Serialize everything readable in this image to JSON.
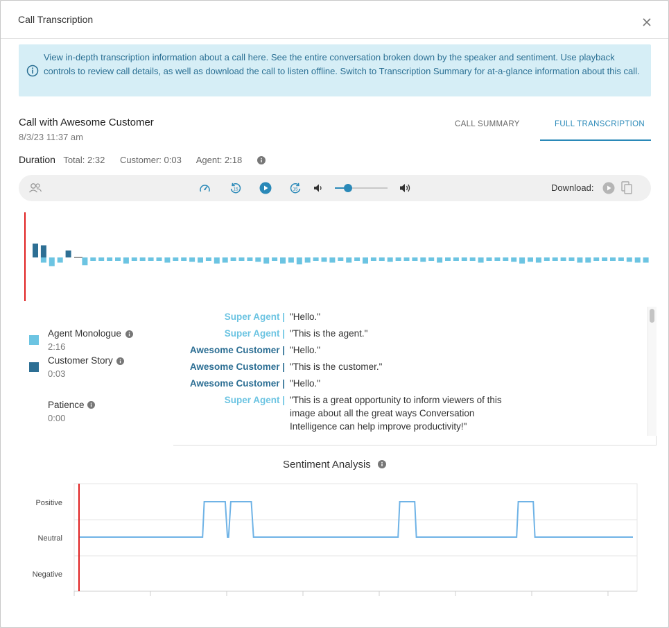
{
  "modal": {
    "title": "Call Transcription"
  },
  "banner": {
    "text": "View in-depth transcription information about a call here. See the entire conversation broken down by the speaker and sentiment. Use playback controls to review call details, as well as download the call to listen offline. Switch to Transcription Summary for at-a-glance information about this call."
  },
  "call": {
    "title": "Call with Awesome Customer",
    "datetime": "8/3/23 11:37 am"
  },
  "tabs": {
    "summary": "CALL SUMMARY",
    "full": "FULL TRANSCRIPTION",
    "active": "FULL TRANSCRIPTION"
  },
  "duration": {
    "label": "Duration",
    "total": "Total: 2:32",
    "customer": "Customer: 0:03",
    "agent": "Agent: 2:18"
  },
  "player": {
    "download_label": "Download:",
    "volume_level": 0.25
  },
  "colors": {
    "agent": "#6cc4e2",
    "customer": "#2d6f94",
    "accent": "#2a89b8",
    "playhead": "#e02020",
    "banner_bg": "#d6eef6"
  },
  "legend": {
    "agent_label": "Agent Monologue",
    "agent_value": "2:16",
    "customer_label": "Customer Story",
    "customer_value": "0:03",
    "patience_label": "Patience",
    "patience_value": "0:00"
  },
  "transcript": [
    {
      "speaker": "Super Agent |",
      "role": "agent",
      "text": "\"Hello.\""
    },
    {
      "speaker": "Super Agent |",
      "role": "agent",
      "text": "\"This is the agent.\""
    },
    {
      "speaker": "Awesome Customer |",
      "role": "customer",
      "text": "\"Hello.\""
    },
    {
      "speaker": "Awesome Customer |",
      "role": "customer",
      "text": "\"This is the customer.\""
    },
    {
      "speaker": "Awesome Customer |",
      "role": "customer",
      "text": "\"Hello.\""
    },
    {
      "speaker": "Super Agent |",
      "role": "agent",
      "text": "\"This is a great opportunity to inform viewers of this image about all the great ways Conversation Intelligence can help improve productivity!\""
    }
  ],
  "sentiment": {
    "title": "Sentiment Analysis",
    "levels": [
      "Positive",
      "Neutral",
      "Negative"
    ]
  },
  "chart_data": [
    {
      "type": "bar",
      "description_series": "speaker activity waveform",
      "series": [
        {
          "name": "Customer Story",
          "x": [
            0,
            1,
            4
          ],
          "values": [
            0.8,
            0.7,
            0.4
          ]
        },
        {
          "name": "Agent Monologue",
          "x": [
            1,
            2,
            3,
            6,
            7,
            8,
            9,
            10,
            11,
            12,
            13,
            14,
            15,
            16,
            17,
            18,
            19,
            20,
            21,
            22,
            23,
            24,
            25,
            26,
            27,
            28,
            29,
            30,
            31,
            32,
            33,
            34,
            35,
            36,
            37,
            38,
            39,
            40,
            41,
            42,
            43,
            44,
            45,
            46,
            47,
            48,
            49,
            50,
            51,
            52,
            53,
            54,
            55,
            56,
            57,
            58,
            59,
            60,
            61,
            62,
            63,
            64,
            65,
            66,
            67,
            68,
            69,
            70,
            71,
            72,
            73,
            74,
            75,
            76,
            77,
            78,
            79,
            80,
            81
          ],
          "values": [
            -0.3,
            -0.5,
            -0.3,
            -0.45,
            -0.2,
            -0.2,
            -0.2,
            -0.2,
            -0.35,
            -0.2,
            -0.2,
            -0.2,
            -0.2,
            -0.3,
            -0.2,
            -0.2,
            -0.25,
            -0.3,
            -0.2,
            -0.35,
            -0.3,
            -0.2,
            -0.2,
            -0.2,
            -0.25,
            -0.35,
            -0.2,
            -0.35,
            -0.3,
            -0.4,
            -0.3,
            -0.2,
            -0.25,
            -0.3,
            -0.2,
            -0.3,
            -0.2,
            -0.35,
            -0.2,
            -0.2,
            -0.25,
            -0.2,
            -0.2,
            -0.2,
            -0.25,
            -0.2,
            -0.3,
            -0.2,
            -0.2,
            -0.2,
            -0.2,
            -0.3,
            -0.2,
            -0.2,
            -0.2,
            -0.25,
            -0.35,
            -0.25,
            -0.3,
            -0.2,
            -0.2,
            -0.2,
            -0.2,
            -0.3,
            -0.3,
            -0.2,
            -0.2,
            -0.2,
            -0.2,
            -0.25,
            -0.3,
            -0.3,
            -0.3,
            -0.25,
            -0.2,
            -0.2,
            -0.25,
            -0.3,
            -0.25
          ]
        }
      ]
    },
    {
      "type": "line",
      "title": "Sentiment Analysis",
      "y_categories": [
        "Positive",
        "Neutral",
        "Negative"
      ],
      "xlim": [
        0,
        100
      ],
      "series": [
        {
          "x": [
            0,
            22.3,
            22.6,
            26.4,
            26.8,
            27.0,
            27.4,
            31.1,
            31.5,
            57.6,
            57.9,
            60.6,
            60.9,
            79.0,
            79.3,
            82.0,
            82.3,
            100
          ],
          "y": [
            0,
            0,
            1,
            1,
            0,
            0,
            1,
            1,
            0,
            0,
            1,
            1,
            0,
            0,
            1,
            1,
            0,
            0
          ]
        }
      ]
    }
  ]
}
